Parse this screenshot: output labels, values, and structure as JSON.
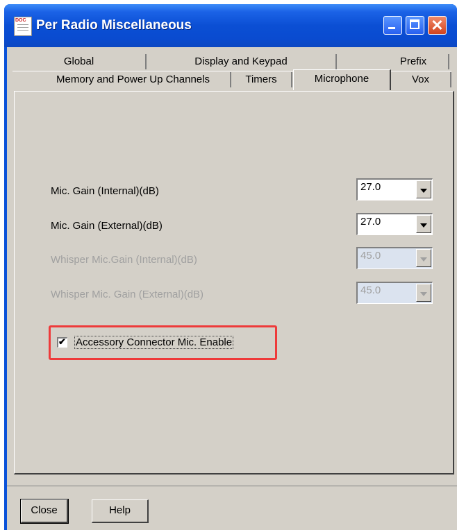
{
  "window": {
    "title": "Per Radio Miscellaneous",
    "icon": "doc-icon",
    "icon_text": "DOC"
  },
  "tabs": {
    "row1": [
      {
        "label": "Global"
      },
      {
        "label": "Display and Keypad"
      },
      {
        "label": "Prefix"
      }
    ],
    "row2": [
      {
        "label": "Memory and Power Up Channels"
      },
      {
        "label": "Timers"
      },
      {
        "label": "Microphone",
        "active": true
      },
      {
        "label": "Vox"
      }
    ]
  },
  "settings": [
    {
      "label": "Mic. Gain (Internal)(dB)",
      "value": "27.0",
      "enabled": true
    },
    {
      "label": "Mic. Gain (External)(dB)",
      "value": "27.0",
      "enabled": true
    },
    {
      "label": "Whisper Mic.Gain (Internal)(dB)",
      "value": "45.0",
      "enabled": false
    },
    {
      "label": "Whisper Mic. Gain (External)(dB)",
      "value": "45.0",
      "enabled": false
    }
  ],
  "accessory_checkbox": {
    "label": "Accessory Connector Mic. Enable",
    "checked": true,
    "highlight_color": "#ee3a3a"
  },
  "buttons": {
    "close": "Close",
    "help": "Help"
  },
  "colors": {
    "titlebar": "#0a52d9",
    "dialog_bg": "#d4d0c8"
  }
}
